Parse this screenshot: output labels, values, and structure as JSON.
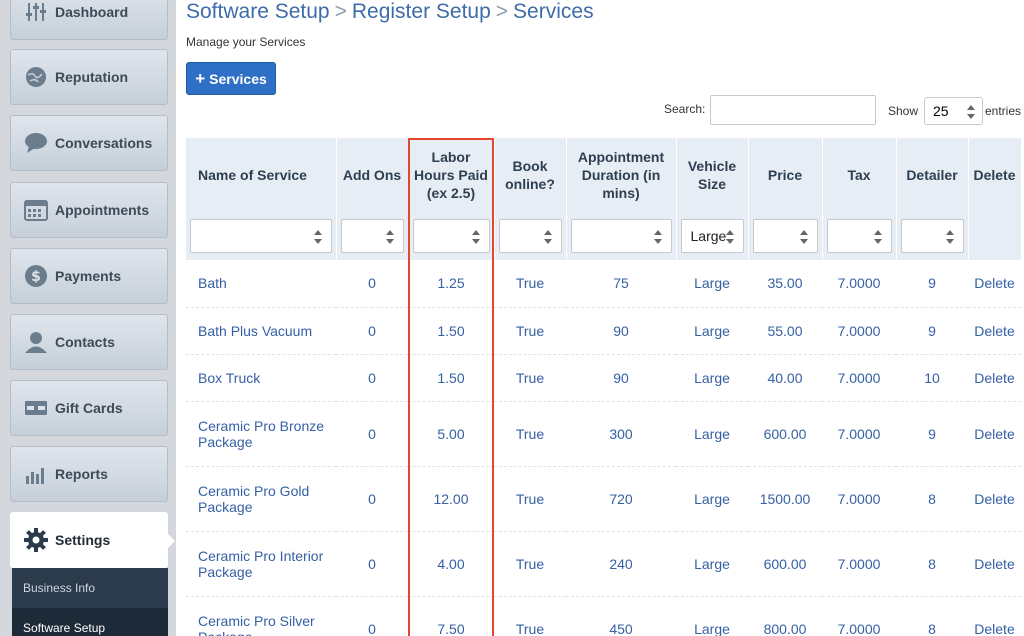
{
  "sidebar": {
    "items": [
      {
        "label": "Dashboard",
        "icon": "sliders-icon"
      },
      {
        "label": "Reputation",
        "icon": "globe-icon"
      },
      {
        "label": "Conversations",
        "icon": "chat-bubble-icon"
      },
      {
        "label": "Appointments",
        "icon": "calendar-icon"
      },
      {
        "label": "Payments",
        "icon": "dollar-coin-icon"
      },
      {
        "label": "Contacts",
        "icon": "person-icon"
      },
      {
        "label": "Gift Cards",
        "icon": "gift-card-icon"
      },
      {
        "label": "Reports",
        "icon": "bar-chart-icon"
      },
      {
        "label": "Settings",
        "icon": "gear-icon"
      }
    ],
    "submenu": [
      "Business Info",
      "Software Setup"
    ]
  },
  "header": {
    "crumbs": [
      "Software Setup",
      "Register Setup",
      "Services"
    ],
    "separator": ">",
    "subtitle": "Manage your Services"
  },
  "toolbar": {
    "add_button": "Services",
    "search_label": "Search:",
    "search_placeholder": "",
    "show_label": "Show",
    "entries_value": "25",
    "entries_label": "entries"
  },
  "table": {
    "columns": [
      "Name of Service",
      "Add Ons",
      "Labor Hours Paid (ex 2.5)",
      "Book online?",
      "Appointment Duration (in mins)",
      "Vehicle Size",
      "Price",
      "Tax",
      "Detailer",
      "Delete"
    ],
    "vehicle_size_filter": "Large",
    "rows": [
      {
        "name": "Bath",
        "add_ons": "0",
        "labor": "1.25",
        "book": "True",
        "duration": "75",
        "size": "Large",
        "price": "35.00",
        "tax": "7.0000",
        "detailer": "9",
        "delete": "Delete"
      },
      {
        "name": "Bath Plus Vacuum",
        "add_ons": "0",
        "labor": "1.50",
        "book": "True",
        "duration": "90",
        "size": "Large",
        "price": "55.00",
        "tax": "7.0000",
        "detailer": "9",
        "delete": "Delete"
      },
      {
        "name": "Box Truck",
        "add_ons": "0",
        "labor": "1.50",
        "book": "True",
        "duration": "90",
        "size": "Large",
        "price": "40.00",
        "tax": "7.0000",
        "detailer": "10",
        "delete": "Delete"
      },
      {
        "name": "Ceramic Pro Bronze Package",
        "add_ons": "0",
        "labor": "5.00",
        "book": "True",
        "duration": "300",
        "size": "Large",
        "price": "600.00",
        "tax": "7.0000",
        "detailer": "9",
        "delete": "Delete"
      },
      {
        "name": "Ceramic Pro Gold Package",
        "add_ons": "0",
        "labor": "12.00",
        "book": "True",
        "duration": "720",
        "size": "Large",
        "price": "1500.00",
        "tax": "7.0000",
        "detailer": "8",
        "delete": "Delete"
      },
      {
        "name": "Ceramic Pro Interior Package",
        "add_ons": "0",
        "labor": "4.00",
        "book": "True",
        "duration": "240",
        "size": "Large",
        "price": "600.00",
        "tax": "7.0000",
        "detailer": "8",
        "delete": "Delete"
      },
      {
        "name": "Ceramic Pro Silver Package",
        "add_ons": "0",
        "labor": "7.50",
        "book": "True",
        "duration": "450",
        "size": "Large",
        "price": "800.00",
        "tax": "7.0000",
        "detailer": "8",
        "delete": "Delete"
      }
    ]
  },
  "colors": {
    "link": "#3560a4",
    "header_title": "#3d6ca8",
    "button": "#2f6fc6",
    "highlight": "#e3452e",
    "table_header_bg": "#e6edf5"
  }
}
